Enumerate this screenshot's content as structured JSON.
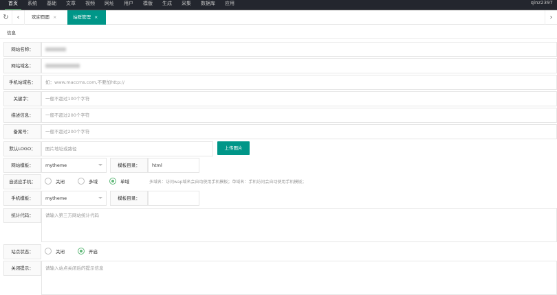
{
  "topnav": {
    "items": [
      "首页",
      "系统",
      "基础",
      "文章",
      "视频",
      "网址",
      "用户",
      "模版",
      "生成",
      "采集",
      "数据库",
      "应用"
    ],
    "user": "qinz2397"
  },
  "tabs": [
    {
      "label": "欢迎页面"
    },
    {
      "label": "站群管理"
    }
  ],
  "section": "信息",
  "form": {
    "site_name": {
      "label": "网站名称："
    },
    "site_domain": {
      "label": "网站域名："
    },
    "mobile_domain": {
      "label": "手机站域名：",
      "placeholder": "如：www.maccms.com,不要加http://"
    },
    "keywords": {
      "label": "关键字：",
      "placeholder": "一般不超过100个字符"
    },
    "description": {
      "label": "描述信息：",
      "placeholder": "一般不超过200个字符"
    },
    "icp": {
      "label": "备案号：",
      "placeholder": "一般不超过200个字符"
    },
    "logo": {
      "label": "默认LOGO：",
      "placeholder": "图片地址或路径",
      "upload": "上传图片"
    },
    "template": {
      "label": "网站模板：",
      "value": "mytheme",
      "dir_label": "模板目录：",
      "dir_value": "html"
    },
    "adaptive": {
      "label": "自适应手机：",
      "options": [
        "关闭",
        "多域",
        "单域"
      ],
      "selected": "单域",
      "hint": "多域名：访问wap域名会自动使用手机模板；单域名：手机访问会自动使用手机模板；"
    },
    "mobile_template": {
      "label": "手机模板：",
      "value": "mytheme",
      "dir_label": "模板目录：",
      "dir_value": ""
    },
    "stats": {
      "label": "统计代码：",
      "placeholder": "请输入第三方网站统计代码"
    },
    "status": {
      "label": "站点状态：",
      "options": [
        "关闭",
        "开启"
      ],
      "selected": "开启"
    },
    "close_tip": {
      "label": "关闭提示：",
      "placeholder": "请输入站点关闭后的提示信息"
    }
  },
  "colors": {
    "accent": "#009688",
    "topbar": "#23262e",
    "radio": "#5fb878"
  }
}
